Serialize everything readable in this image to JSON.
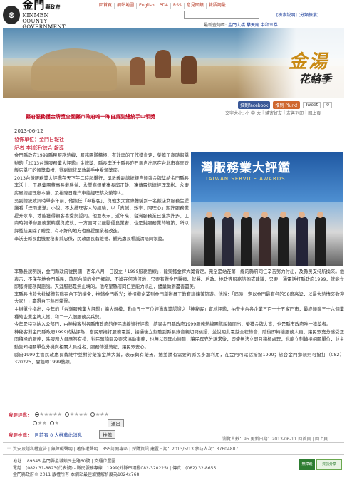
{
  "header": {
    "logo_main": "金門",
    "logo_suffix": "縣政府",
    "logo_en1": "KINMEN",
    "logo_en2": "COUNTY GOVERNMENT",
    "nav": [
      "回首頁",
      "網站地圖",
      "English",
      "PDA",
      "RSS",
      "意見回饋",
      "雙語詞彙"
    ],
    "search_links": [
      "[檢索說明]",
      "[分類檢索]"
    ],
    "latest_label": "最新查詢區:",
    "latest_link": "金門大橋 攀天廟 中和五券"
  },
  "banner": {
    "title": "金湯",
    "subtitle": "花絡季"
  },
  "share": {
    "facebook": "推到facebook",
    "plurk": "推到 Plurk!",
    "tweet": "Tweet",
    "tweet_count": "0"
  },
  "tools": {
    "font_size": "文字大小:",
    "small": "小",
    "medium": "中",
    "large": "大",
    "forward": "轉寄好友",
    "friendly_print": "友善列印",
    "back": "回上頁"
  },
  "article": {
    "title": "縣府服務獲金牌獎全國縣市政府唯一昨自吳副總統手中領獎",
    "date": "2013-06-12",
    "unit": "發佈單位：金門日報社",
    "reporter": "記者 李增汪/綜合 報導",
    "paragraphs_left": [
      "金門縣政府1999縣民服務熱線，服務團隊積極、有效率的工作獲肯定，榮獲工商時報舉辦的「2013台灣服務業大評鑑」金牌獎，縣長李沃士縣長昨日親自出席在台北市喜來登飯店舉行的頒獎典禮，從副總統吳敦義手中受頒獎座。",
      "2013台灣服務業大評鑑在天下午二時起舉行，吳敦義副總統親自頒發金牌獎給金門縣長李沃士、王品集團董事長戴勝益、永豐商銀董事長邱正雄、遠傳電信總經理李彬、永慶房屋總經理廖本勝、及裕隆日產汽車總經理蔡文榮等人。",
      "吳副總統致詞時舉多年前，他擔任「神秘客」，與他太太實際體驗到一名飯店女服務生提議看「煙雨濛濛」小說，不太搭理客人的經驗，以「真誠、效率、同理心」期許服務業提升水準，才能獲得顧客喜愛與認同。他並表示，近年來，台灣服務業已進步許多，工商時報舉辦服務業精選與成就，一方面可以鼓勵優良業者，也是對服務業的鞭策，所以評鑑結果除了贈獎，有不好的地方也應提醒業者改進。",
      "李沃士縣長由機要秘書郝忠傑，民政處長翁維德、觀光處長楊誠清陪同領獎。"
    ],
    "paragraphs_full": [
      "李縣長說明說，金門縣政府從民國一百年八月一日設立「1999服務熱線」，能榮獲金牌大獎肯定，完全是站在第一線的縣府同仁辛苦努力付出，及縣民支持所換來。他表示，不僅在地金門縣民，旅居台灣的金門鄉親，不論在何時何地，只要有對金門醫療、就醫、戶政、地政等服務諮詢或建議，只要一通電話打縣政府1999，就能立即獲得服務與諮詢。天涯服務是無止境的，他希望縣府同仁更能力以赴，儘量做到盡善盡美。",
      "李縣長也趁大批媒體蒞臨在台下的機會，推銷金門觀光；並招攬企業到金門舉辦員工教育訓練兼旅遊。他說：「屆時一定以金門最有名的58度高粱，以最大熱情來歡迎大家！」贏得台下熱烈掌聲。",
      "主辦單位指出，今年的「台灣服務業大評鑑」擴大規模，動員五十三位經過專業認證之「神秘客」實地評鑑，抽查全台各企業三百一十五家門市，最終頒發三十六個業種的企業金牌大賞，和二十六個服務尖兵獎。",
      "今年是特別納入公部門，由神秘客對各縣市政府的便民專線進行評鑑，結果金門縣政府1999服務熱線團隊脫穎而出，榮獲金牌大賞，也是縣市政府唯一獲獎者。",
      "神秘客對金門縣政府1999的點評為：當民眾撥打服務電話，接通後立刻聽到縣長錄音親切問候語，並說明此電話全程錄音，隨後即轉接服務人員，讓民眾充分感受正面積極的服務，除服務人員應答有禮，對民眾詢問及要求協助事務，也無以同理心傾聽，讓民眾充分訴求後，即使無法立即且積極處理，也能立刻轉接相關單位，並主動告知相關單位分機與相關人員姓名，服務傳遞流程，讓民眾安心。",
      "縣府1999主管民政處長翁維中並對於榮獲金牌大賞，表示與有榮焉。她並請有需要的縣民多加利用，在金門可電話撥撥1999；旅台金門鄉親則可撥打（082）320225，會經轉1999熱線。"
    ]
  },
  "photo": {
    "board_text": "灣服務業大評鑑",
    "board_sub": "TAIWAN SERVICE AWARDS"
  },
  "rating": {
    "label": "我要評鑑：",
    "options": [
      "5",
      "4",
      "3",
      "2",
      "1"
    ],
    "send": "送出",
    "recommend_label": "我要推薦：",
    "recommend_text": "目前有 0 人推薦此消息",
    "recommend_button": "推薦"
  },
  "footer": {
    "update": "瀏覽人數：95 更新日期：2013-06-11 回首頁 | 回上頁",
    "links": "::: 資安及隱私權宣告 | 無障礙聲明 | 著作權聲明 | RSS訂閱專區 | 採購資訊 建置日期：2013/5/13 參訪人次：37604807",
    "address": "地址： 89345 金門縣金城鎮民生路60號 | 交通位置圖",
    "phone": "電話：(082) 31-8823(代表號) - 縣民服務專線：1999(外縣市請撥082-320225) | 傳真：(082) 32-8655",
    "copyright": "金門縣政府© 2011 版權所有 本網站最佳瀏覽解析度為1024x768",
    "badge_a": "無障礙",
    "badge_b": "資訊分享"
  }
}
